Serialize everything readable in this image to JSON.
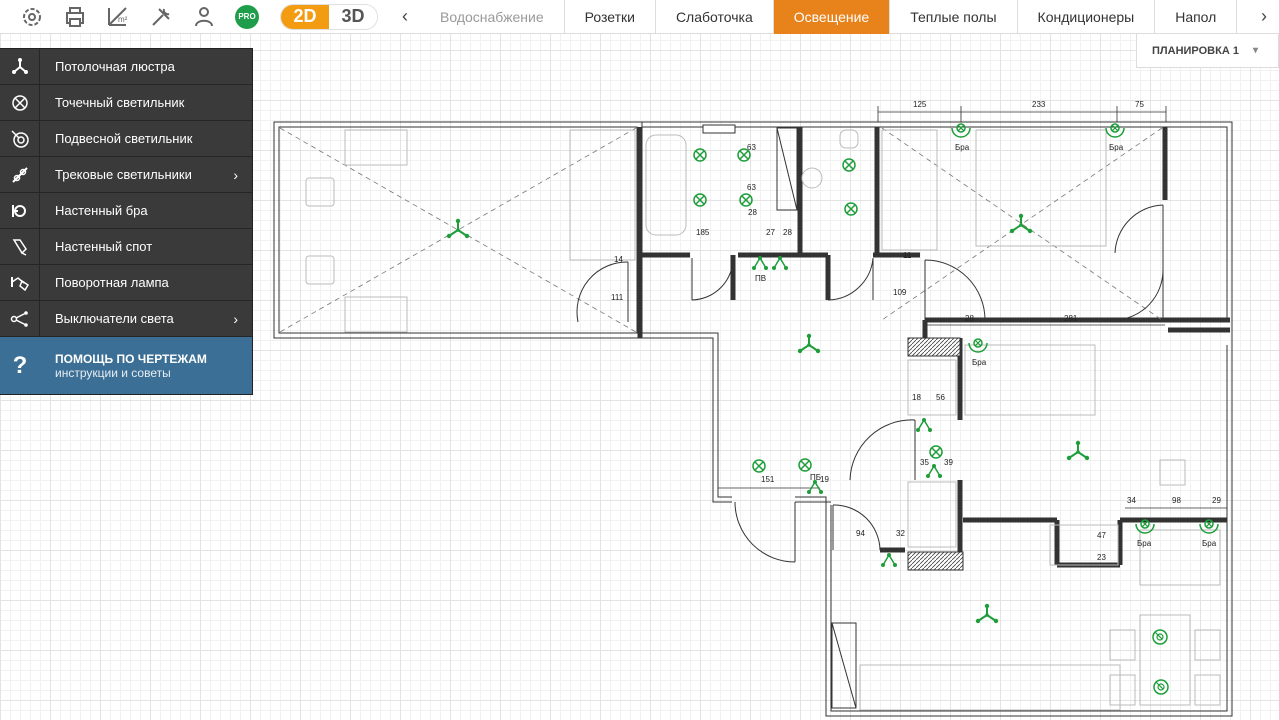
{
  "toolbar": {
    "icons": [
      "settings-icon",
      "print-icon",
      "area-icon",
      "tools-icon",
      "expert-icon",
      "pro-icon"
    ],
    "pro_label": "PRO",
    "mode_2d": "2D",
    "mode_3d": "3D"
  },
  "tabs": [
    {
      "label": "Водоснабжение",
      "state": "disabled"
    },
    {
      "label": "Розетки",
      "state": "normal"
    },
    {
      "label": "Слаботочка",
      "state": "normal"
    },
    {
      "label": "Освещение",
      "state": "active"
    },
    {
      "label": "Теплые полы",
      "state": "normal"
    },
    {
      "label": "Кондиционеры",
      "state": "normal"
    },
    {
      "label": "Напол",
      "state": "normal"
    }
  ],
  "colors": {
    "accent": "#e8821a",
    "toggle_active": "#f39c12",
    "menu_bg": "#3a3a3a",
    "help_bg": "#3b6f95",
    "fixture": "#1e9e3a"
  },
  "menu": {
    "items": [
      {
        "label": "Потолочная люстра",
        "icon": "chandelier-icon",
        "submenu": false
      },
      {
        "label": "Точечный светильник",
        "icon": "spotlight-icon",
        "submenu": false
      },
      {
        "label": "Подвесной светильник",
        "icon": "pendant-lamp-icon",
        "submenu": false
      },
      {
        "label": "Трековые светильники",
        "icon": "track-light-icon",
        "submenu": true
      },
      {
        "label": "Настенный бра",
        "icon": "wall-sconce-icon",
        "submenu": false
      },
      {
        "label": "Настенный спот",
        "icon": "wall-spot-icon",
        "submenu": false
      },
      {
        "label": "Поворотная лампа",
        "icon": "swivel-lamp-icon",
        "submenu": false
      },
      {
        "label": "Выключатели света",
        "icon": "switch-icon",
        "submenu": true
      }
    ],
    "help_title": "ПОМОЩЬ ПО ЧЕРТЕЖАМ",
    "help_sub": "инструкции и советы",
    "help_icon": "?"
  },
  "layout_selector": {
    "label": "ПЛАНИРОВКА 1"
  },
  "plan": {
    "dims": [
      "125",
      "233",
      "75",
      "63",
      "63",
      "28",
      "185",
      "27",
      "28",
      "14",
      "111",
      "11",
      "109",
      "28",
      "281",
      "18",
      "56",
      "35",
      "39",
      "151",
      "19",
      "94",
      "32",
      "34",
      "98",
      "29",
      "47",
      "23"
    ],
    "labels": [
      "Бра",
      "Бра",
      "Бра",
      "Бра",
      "Бра",
      "ПВ",
      "ПБ"
    ]
  }
}
